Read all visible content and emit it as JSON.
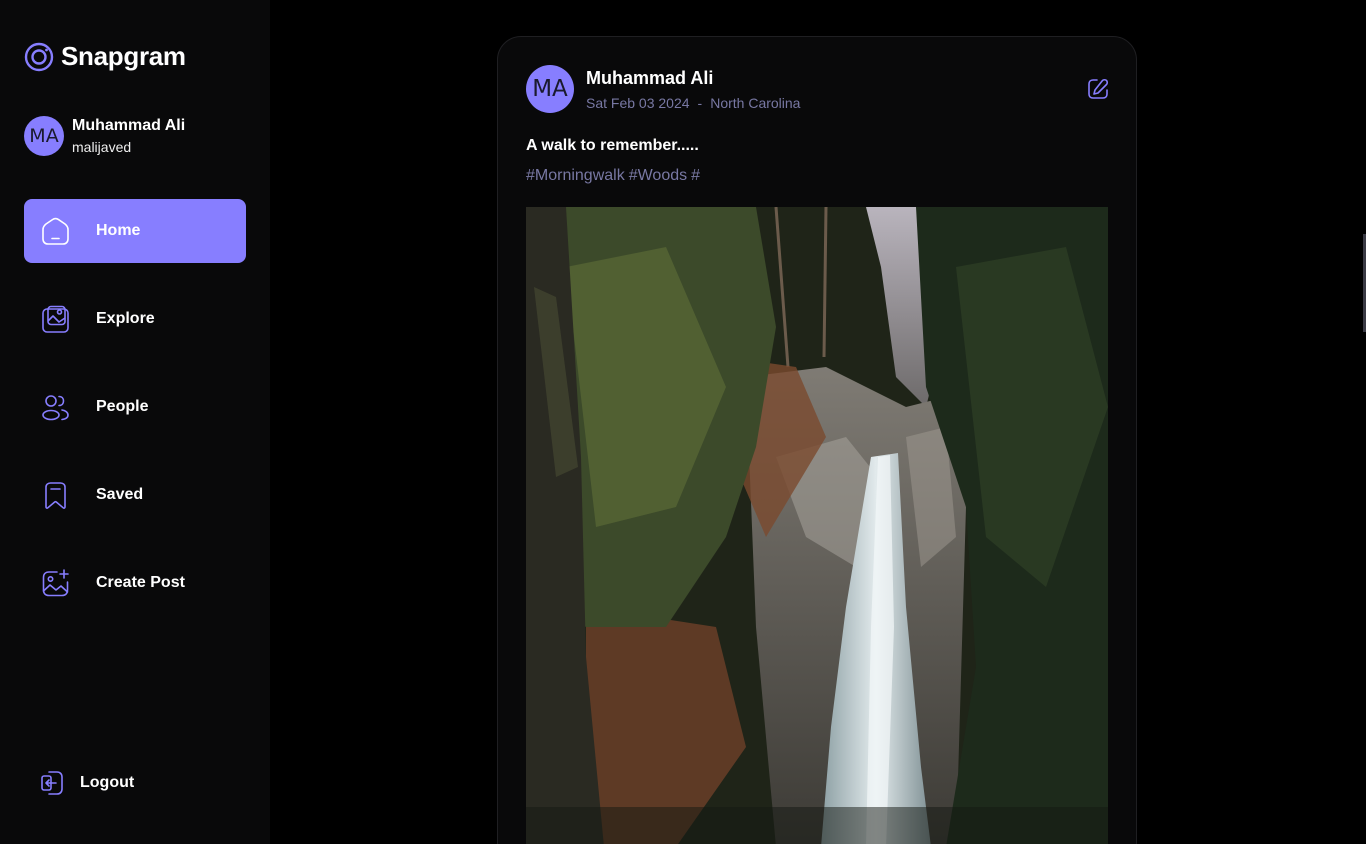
{
  "brand": {
    "name": "Snapgram",
    "accent": "#877eff"
  },
  "current_user": {
    "initials": "MA",
    "name": "Muhammad Ali",
    "handle": "malijaved"
  },
  "nav": [
    {
      "label": "Home",
      "icon": "home-icon",
      "active": true
    },
    {
      "label": "Explore",
      "icon": "gallery-icon",
      "active": false
    },
    {
      "label": "People",
      "icon": "people-icon",
      "active": false
    },
    {
      "label": "Saved",
      "icon": "bookmark-icon",
      "active": false
    },
    {
      "label": "Create Post",
      "icon": "image-add-icon",
      "active": false
    }
  ],
  "logout": {
    "label": "Logout",
    "icon": "logout-icon"
  },
  "post": {
    "author_initials": "MA",
    "author": "Muhammad Ali",
    "date": "Sat Feb 03 2024",
    "separator": "-",
    "location": "North Carolina",
    "caption": "A walk to remember.....",
    "tags": [
      "#Morningwalk",
      "#Woods",
      "#"
    ],
    "edit_icon": "edit-icon",
    "image_subject": "waterfall-in-forest-photo"
  }
}
